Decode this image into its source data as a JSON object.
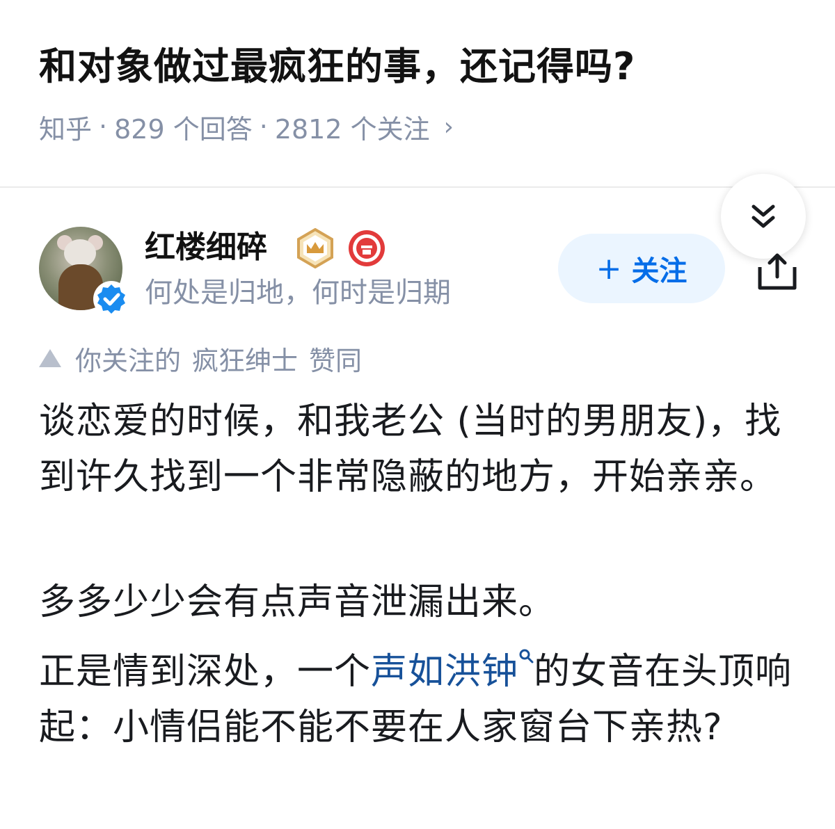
{
  "question": {
    "title": "和对象做过最疯狂的事，还记得吗?",
    "source": "知乎",
    "answers": "829 个回答",
    "followers": "2812 个关注",
    "sep": "·"
  },
  "author": {
    "name": "红楼细碎",
    "bio": "何处是归地，何时是归期",
    "follow_label": "关注",
    "follow_plus": "+"
  },
  "voted": {
    "prefix": "你关注的",
    "user": "疯狂绅士",
    "suffix": "赞同"
  },
  "content": {
    "p1": "谈恋爱的时候，和我老公 (当时的男朋友)，找到许久找到一个非常隐蔽的地方，开始亲亲。",
    "p2": "多多少少会有点声音泄漏出来。",
    "p3_before": "正是情到深处，一个",
    "p3_link": "声如洪钟",
    "p3_after": "的女音在头顶响起：小情侣能不能不要在人家窗台下亲热?"
  },
  "icons": {
    "collapse": "double-chevron-down-icon",
    "share": "share-icon",
    "verify": "verified-check-icon",
    "crown_badge": "crown-badge-icon",
    "red_badge": "red-medal-badge-icon",
    "upvote": "upvote-triangle-icon",
    "link_search": "search-icon"
  },
  "colors": {
    "brand_blue": "#056de8",
    "link_blue": "#175199",
    "meta_gray": "#8590a6",
    "follow_bg": "#ebf5ff"
  }
}
